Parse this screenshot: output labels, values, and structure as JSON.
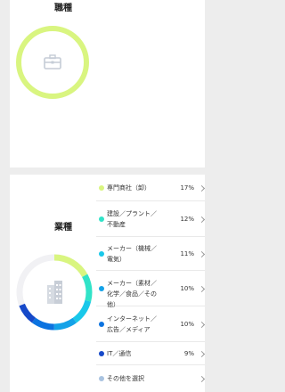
{
  "job_type": {
    "title": "職種",
    "icon": "briefcase-icon",
    "ring_color": "#d9f580"
  },
  "industry": {
    "title": "業種",
    "icon": "building-icon",
    "items": [
      {
        "label": "専門商社（卸）",
        "percent": "17%",
        "value": 17,
        "color": "#d9f580"
      },
      {
        "label": "建設／プラント／不動産",
        "percent": "12%",
        "value": 12,
        "color": "#31e3c8"
      },
      {
        "label": "メーカー（機械／電気）",
        "percent": "11%",
        "value": 11,
        "color": "#19c8ea"
      },
      {
        "label": "メーカー（素材／化学／食品／その他）",
        "percent": "10%",
        "value": 10,
        "color": "#14a2e8"
      },
      {
        "label": "インターネット／広告／メディア",
        "percent": "10%",
        "value": 10,
        "color": "#0c73e0"
      },
      {
        "label": "IT／通信",
        "percent": "9%",
        "value": 9,
        "color": "#1649c9"
      },
      {
        "label": "その他を選択",
        "percent": "",
        "value": 31,
        "color": "#a9c3e0"
      }
    ]
  }
}
